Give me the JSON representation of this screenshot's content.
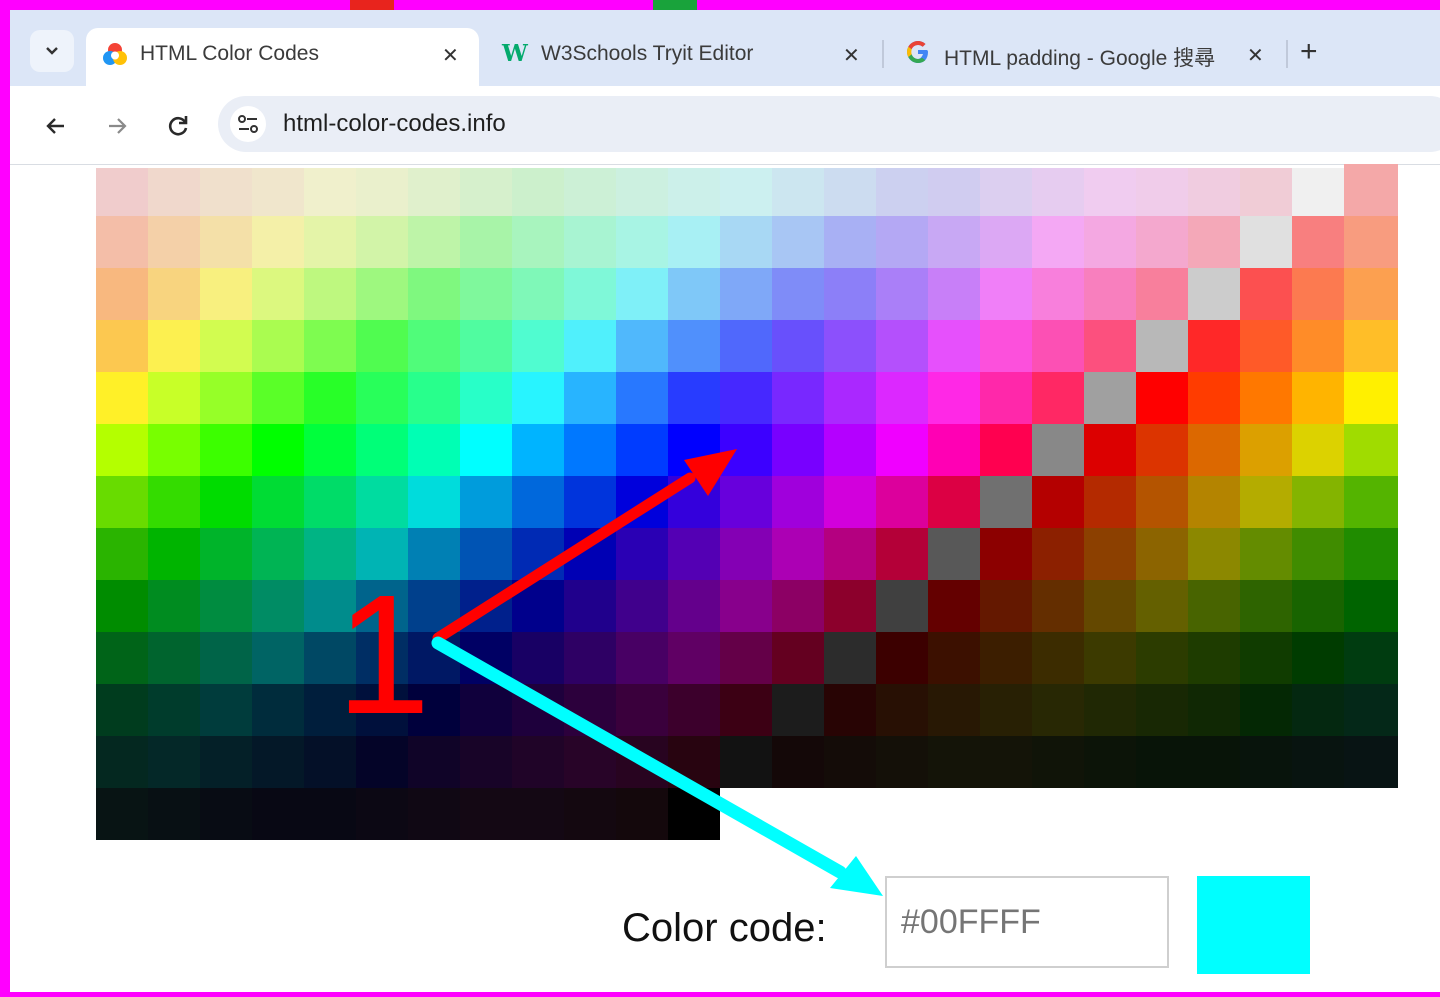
{
  "browser": {
    "tabs": [
      {
        "title": "HTML Color Codes",
        "favicon": "color-wheel-icon",
        "active": true
      },
      {
        "title": "W3Schools Tryit Editor",
        "favicon": "w3schools-icon",
        "favicon_text": "W",
        "active": false
      },
      {
        "title": "HTML padding - Google 搜尋",
        "favicon": "google-icon",
        "active": false
      }
    ],
    "tab_close_glyph": "✕",
    "new_tab_glyph": "+",
    "url": "html-color-codes.info"
  },
  "picker": {
    "rows": [
      [
        "#f0cccc",
        "#f0d8cc",
        "#f0e0cc",
        "#f0e6cc",
        "#f0f0cc",
        "#eaf0cc",
        "#e0f0cc",
        "#d6f0cc",
        "#ccf0cc",
        "#ccf0d6",
        "#ccf0e0",
        "#ccf0ea",
        "#ccf0f0",
        "#cce6f0",
        "#ccdcf0",
        "#ccd0f0",
        "#d0ccf0",
        "#dccff0",
        "#e6ccf0",
        "#f0ccf0",
        "#f0ccea",
        "#f0cce0",
        "#f0ccd6",
        "#f0f0f0"
      ],
      [
        "#f4a8a8",
        "#f4bea8",
        "#f4d0a8",
        "#f4e0a8",
        "#f4f0a8",
        "#e4f4a8",
        "#d2f4a8",
        "#bef4a8",
        "#a8f4a8",
        "#a8f4be",
        "#a8f4d2",
        "#a8f4e4",
        "#a8f0f4",
        "#a8d8f4",
        "#a8c6f4",
        "#a8b0f4",
        "#b4a8f4",
        "#c8a8f4",
        "#dca8f4",
        "#f4a8f4",
        "#f4a8e2",
        "#f4a8ce",
        "#f4a8b8",
        "#e0e0e0"
      ],
      [
        "#f87f7f",
        "#f89c7f",
        "#f8b87f",
        "#f8d47f",
        "#f8f07f",
        "#dcf87f",
        "#bef87f",
        "#9ef87f",
        "#7ff87f",
        "#7ff89c",
        "#7ff8b8",
        "#7ff8d8",
        "#7ff0f8",
        "#7fc8f8",
        "#7fa8f8",
        "#7f8cf8",
        "#8c7ff8",
        "#aa7ff8",
        "#c87ff8",
        "#f07ff8",
        "#f87fdc",
        "#f87fbe",
        "#f87f9c",
        "#cccccc"
      ],
      [
        "#fc5050",
        "#fc7a50",
        "#fca050",
        "#fcc850",
        "#fcf050",
        "#d2fc50",
        "#aafc50",
        "#7efc50",
        "#50fc50",
        "#50fc7a",
        "#50fca0",
        "#50fcd0",
        "#50f0fc",
        "#50b8fc",
        "#5090fc",
        "#5068fc",
        "#6850fc",
        "#8c50fc",
        "#b450fc",
        "#e650fc",
        "#fc50dc",
        "#fc50b4",
        "#fc507e",
        "#b8b8b8"
      ],
      [
        "#ff2828",
        "#ff5a28",
        "#ff8c28",
        "#ffbe28",
        "#fff028",
        "#c8ff28",
        "#96ff28",
        "#5aff28",
        "#28ff28",
        "#28ff5a",
        "#28ff8c",
        "#28ffc8",
        "#28f4ff",
        "#28b4ff",
        "#2878ff",
        "#283cff",
        "#4628ff",
        "#7828ff",
        "#aa28ff",
        "#dc28ff",
        "#ff28e6",
        "#ff28aa",
        "#ff2864",
        "#a0a0a0"
      ],
      [
        "#ff0000",
        "#ff3c00",
        "#ff7800",
        "#ffb400",
        "#fff000",
        "#b4ff00",
        "#78ff00",
        "#3cff00",
        "#00ff00",
        "#00ff3c",
        "#00ff78",
        "#00ffb4",
        "#00ffff",
        "#00b4ff",
        "#0078ff",
        "#003cff",
        "#0000ff",
        "#3c00ff",
        "#7800ff",
        "#b400ff",
        "#f000ff",
        "#ff00b4",
        "#ff0050",
        "#888888"
      ],
      [
        "#dc0000",
        "#dc3400",
        "#dc6800",
        "#dca000",
        "#dcd200",
        "#a0dc00",
        "#68dc00",
        "#34dc00",
        "#00dc00",
        "#00dc34",
        "#00dc68",
        "#00dca0",
        "#00dcdc",
        "#009cdc",
        "#0068dc",
        "#0034dc",
        "#0000dc",
        "#3400dc",
        "#6800dc",
        "#a000dc",
        "#d200dc",
        "#dc009c",
        "#dc0044",
        "#707070"
      ],
      [
        "#b40000",
        "#b42a00",
        "#b45400",
        "#b48400",
        "#b4ac00",
        "#84b400",
        "#54b400",
        "#2ab400",
        "#00b400",
        "#00b42a",
        "#00b454",
        "#00b484",
        "#00b4b4",
        "#0080b4",
        "#0054b4",
        "#002ab4",
        "#0000b4",
        "#2a00b4",
        "#5400b4",
        "#8400b4",
        "#ac00b4",
        "#b40080",
        "#b40038",
        "#585858"
      ],
      [
        "#8c0000",
        "#8c2000",
        "#8c4000",
        "#8c6400",
        "#8c8800",
        "#648c00",
        "#408c00",
        "#208c00",
        "#008c00",
        "#008c20",
        "#008c40",
        "#008c64",
        "#008c8c",
        "#00648c",
        "#00408c",
        "#00208c",
        "#00008c",
        "#20008c",
        "#40008c",
        "#64008c",
        "#88008c",
        "#8c0064",
        "#8c002c",
        "#404040"
      ],
      [
        "#640000",
        "#641800",
        "#642e00",
        "#644800",
        "#646000",
        "#486400",
        "#2e6400",
        "#186400",
        "#006400",
        "#006418",
        "#00642e",
        "#006448",
        "#006464",
        "#004864",
        "#002e64",
        "#001864",
        "#000064",
        "#180064",
        "#2e0064",
        "#480064",
        "#600064",
        "#640048",
        "#640020",
        "#2c2c2c"
      ],
      [
        "#3c0000",
        "#3c1000",
        "#3c1e00",
        "#3c2c00",
        "#3c3a00",
        "#2c3c00",
        "#1e3c00",
        "#103c00",
        "#003c00",
        "#003c10",
        "#003c1e",
        "#003c2c",
        "#003c3c",
        "#002c3c",
        "#001e3c",
        "#00103c",
        "#00003c",
        "#10003c",
        "#1e003c",
        "#2c003c",
        "#3a003c",
        "#3c002c",
        "#3c0014",
        "#1c1c1c"
      ],
      [
        "#280404",
        "#281004",
        "#281804",
        "#282004",
        "#282804",
        "#202804",
        "#182804",
        "#102804",
        "#042804",
        "#042810",
        "#042818",
        "#042820",
        "#042828",
        "#042028",
        "#041828",
        "#041028",
        "#040428",
        "#100428",
        "#180428",
        "#200428",
        "#280428",
        "#280420",
        "#280410",
        "#121212"
      ],
      [
        "#140808",
        "#140c08",
        "#141008",
        "#141408",
        "#141408",
        "#101408",
        "#0c1408",
        "#081408",
        "#081408",
        "#08140c",
        "#081410",
        "#081414",
        "#081414",
        "#081014",
        "#080c14",
        "#080814",
        "#080814",
        "#0c0814",
        "#100814",
        "#140814",
        "#140814",
        "#140810",
        "#14080c",
        "#000000"
      ]
    ],
    "label": "Color code:",
    "code_placeholder": "#00FFFF",
    "swatch_color": "#00ffff"
  },
  "annotation": {
    "number": "1",
    "arrow_to_grid_color": "#ff0000",
    "arrow_to_input_color": "#00ffff",
    "frame_color": "#ff00ff"
  }
}
